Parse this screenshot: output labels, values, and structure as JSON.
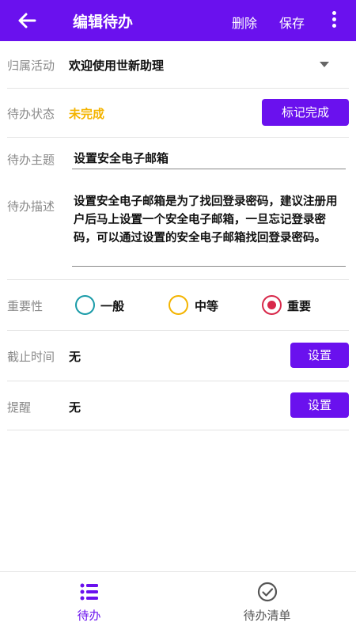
{
  "appbar": {
    "title": "编辑待办",
    "delete_label": "删除",
    "save_label": "保存",
    "back_icon": "arrow-left-icon",
    "more_icon": "more-vertical-icon",
    "color": "#6A11EE"
  },
  "form": {
    "activity": {
      "label": "归属活动",
      "value": "欢迎使用世新助理"
    },
    "status": {
      "label": "待办状态",
      "value": "未完成",
      "value_color": "#F4B400",
      "button": "标记完成"
    },
    "topic": {
      "label": "待办主题",
      "value": "设置安全电子邮箱"
    },
    "description": {
      "label": "待办描述",
      "value": "设置安全电子邮箱是为了找回登录密码，建议注册用户后马上设置一个安全电子邮箱，一旦忘记登录密码，可以通过设置的安全电子邮箱找回登录密码。"
    },
    "importance": {
      "label": "重要性",
      "options": [
        "一般",
        "中等",
        "重要"
      ],
      "selected": "重要",
      "colors": {
        "一般": "#1A9BA8",
        "中等": "#F4B400",
        "重要": "#D8284A"
      }
    },
    "deadline": {
      "label": "截止时间",
      "value": "无",
      "button": "设置"
    },
    "reminder": {
      "label": "提醒",
      "value": "无",
      "button": "设置"
    }
  },
  "bottom_nav": {
    "items": [
      {
        "label": "待办",
        "icon": "list-icon",
        "active": true
      },
      {
        "label": "待办清单",
        "icon": "check-circle-icon",
        "active": false
      }
    ]
  }
}
